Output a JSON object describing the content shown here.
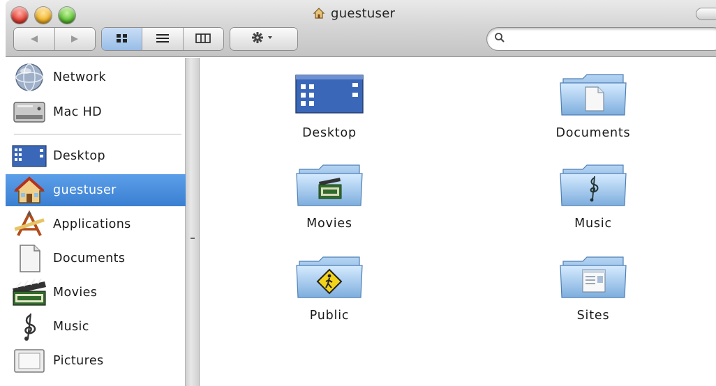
{
  "window": {
    "title": "guestuser"
  },
  "toolbar": {
    "back_icon": "back-arrow-icon",
    "forward_icon": "forward-arrow-icon",
    "view_modes": [
      "icon-view-icon",
      "list-view-icon",
      "column-view-icon"
    ],
    "active_view": "icon",
    "action_icon": "gear-icon",
    "search": {
      "value": "",
      "placeholder": ""
    }
  },
  "sidebar": {
    "devices": [
      {
        "label": "Network",
        "icon": "network-globe-icon"
      },
      {
        "label": "Mac HD",
        "icon": "hard-drive-icon"
      }
    ],
    "places": [
      {
        "label": "Desktop",
        "icon": "desktop-icon"
      },
      {
        "label": "guestuser",
        "icon": "home-icon",
        "selected": true
      },
      {
        "label": "Applications",
        "icon": "applications-icon"
      },
      {
        "label": "Documents",
        "icon": "documents-icon"
      },
      {
        "label": "Movies",
        "icon": "movies-icon"
      },
      {
        "label": "Music",
        "icon": "music-icon"
      },
      {
        "label": "Pictures",
        "icon": "pictures-icon"
      }
    ]
  },
  "content": {
    "items": [
      {
        "label": "Desktop",
        "icon": "desktop-folder-icon"
      },
      {
        "label": "Documents",
        "icon": "documents-folder-icon"
      },
      {
        "label": "Movies",
        "icon": "movies-folder-icon"
      },
      {
        "label": "Music",
        "icon": "music-folder-icon"
      },
      {
        "label": "Public",
        "icon": "public-folder-icon"
      },
      {
        "label": "Sites",
        "icon": "sites-folder-icon"
      }
    ]
  },
  "colors": {
    "selection": "#3a7fd2",
    "folder_blue": "#8ab8e6"
  }
}
